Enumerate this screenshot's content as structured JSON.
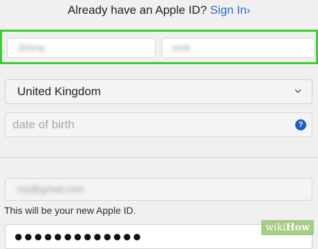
{
  "header": {
    "prompt_text": "Already have an Apple ID?",
    "sign_in_label": "Sign In",
    "sign_in_chevron": "›"
  },
  "name_row": {
    "first_name_value": "Jimmy",
    "last_name_value": "smit"
  },
  "country": {
    "selected": "United Kingdom",
    "icon": "chevron-down-icon"
  },
  "dob": {
    "placeholder": "date of birth",
    "help_icon_glyph": "?"
  },
  "email": {
    "value": "my@gmail.com",
    "helper_text": "This will be your new Apple ID."
  },
  "password": {
    "masked_value": "●●●●●●●●●●●●●"
  },
  "watermark": {
    "wiki": "wiki",
    "how": "How"
  },
  "colors": {
    "highlight": "#35d12d",
    "link": "#2a6bc4",
    "help_icon": "#1a5fbf"
  }
}
